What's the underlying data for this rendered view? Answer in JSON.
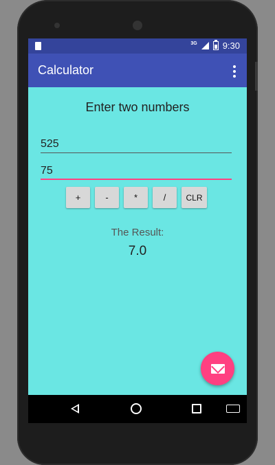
{
  "statusbar": {
    "network": "3G",
    "time": "9:30"
  },
  "appbar": {
    "title": "Calculator"
  },
  "main": {
    "heading": "Enter two numbers",
    "number1": "525",
    "number2": "75",
    "operations": [
      {
        "label": "+"
      },
      {
        "label": "-"
      },
      {
        "label": "*"
      },
      {
        "label": "/"
      },
      {
        "label": "CLR"
      }
    ],
    "result_label": "The Result:",
    "result_value": "7.0"
  },
  "colors": {
    "primary": "#3f51b5",
    "primary_dark": "#34449b",
    "background": "#6ae6e3",
    "accent": "#ff4081"
  },
  "icons": {
    "fab": "email-icon",
    "nav": [
      "back-icon",
      "home-icon",
      "recent-apps-icon",
      "keyboard-icon"
    ]
  }
}
